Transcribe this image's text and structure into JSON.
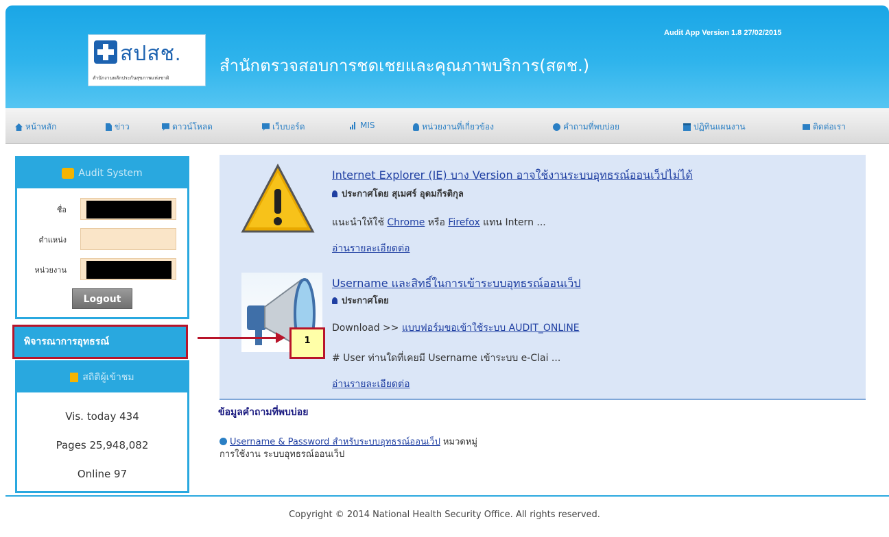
{
  "header": {
    "logo_text": "สปสช.",
    "logo_subtext": "สำนักงานหลักประกันสุขภาพแห่งชาติ",
    "site_title": "สำนักตรวจสอบการชดเชยและคุณภาพบริการ(สตช.)",
    "version": "Audit App Version 1.8 27/02/2015"
  },
  "nav": {
    "items": [
      {
        "label": "หน้าหลัก",
        "icon": "home-icon"
      },
      {
        "label": "ข่าว",
        "icon": "file-icon"
      },
      {
        "label": "ดาวน์โหลด",
        "icon": "chat-icon"
      },
      {
        "label": "เว็บบอร์ด",
        "icon": "chat-icon"
      },
      {
        "label": "MIS",
        "icon": "bar-chart-icon"
      },
      {
        "label": "หน่วยงานที่เกี่ยวข้อง",
        "icon": "user-icon"
      },
      {
        "label": "คำถามที่พบบ่อย",
        "icon": "question-icon"
      },
      {
        "label": "ปฏิทินแผนงาน",
        "icon": "calendar-icon"
      },
      {
        "label": "ติดต่อเรา",
        "icon": "mail-icon"
      }
    ]
  },
  "audit_panel": {
    "title": "Audit System",
    "name_label": "ชื่อ",
    "position_label": "ตำแหน่ง",
    "unit_label": "หน่วยงาน",
    "logout_label": "Logout"
  },
  "consider_button": "พิจารณาการอุทธรณ์",
  "stats": {
    "title": "สถิติผู้เข้าชม",
    "today": "Vis. today 434",
    "pages": "Pages 25,948,082",
    "online": "Online 97"
  },
  "news": [
    {
      "title": "Internet Explorer (IE) บาง Version อาจใช้งานระบบอุทธรณ์ออนเว็ปไม่ได้",
      "by": "ประกาศโดย สุเมศร์ อุดมกีรติกุล",
      "text_prefix": "แนะนำให้ใช้ ",
      "link1": "Chrome",
      "text_mid": " หรือ ",
      "link2": "Firefox",
      "text_suffix": " แทน Intern ...",
      "readmore": "อ่านรายละเอียดต่อ"
    },
    {
      "title": "Username และสิทธิ์ในการเข้าระบบอุทธรณ์ออนเว็ป",
      "by": "ประกาศโดย",
      "text_prefix": "Download >> ",
      "link1": "แบบฟอร์มขอเข้าใช้ระบบ AUDIT_ONLINE",
      "text2": "# User ท่านใดที่เคยมี Username เข้าระบบ e-Clai ...",
      "readmore": "อ่านรายละเอียดต่อ"
    }
  ],
  "annotation": {
    "marker": "1",
    "color": "#b8142a"
  },
  "faq": {
    "heading": "ข้อมูลคำถามที่พบบ่อย",
    "link": "Username & Password สำหรับระบบอุทธรณ์ออนเว็ป",
    "category": " หมวดหมู่",
    "sub": "การใช้งาน ระบบอุทธรณ์ออนเว็ป"
  },
  "footer": "Copyright © 2014 National Health Security Office. All rights reserved.",
  "colors": {
    "header_blue": "#29a8df",
    "accent_red": "#b8142a",
    "link_blue": "#1f3fa2"
  }
}
